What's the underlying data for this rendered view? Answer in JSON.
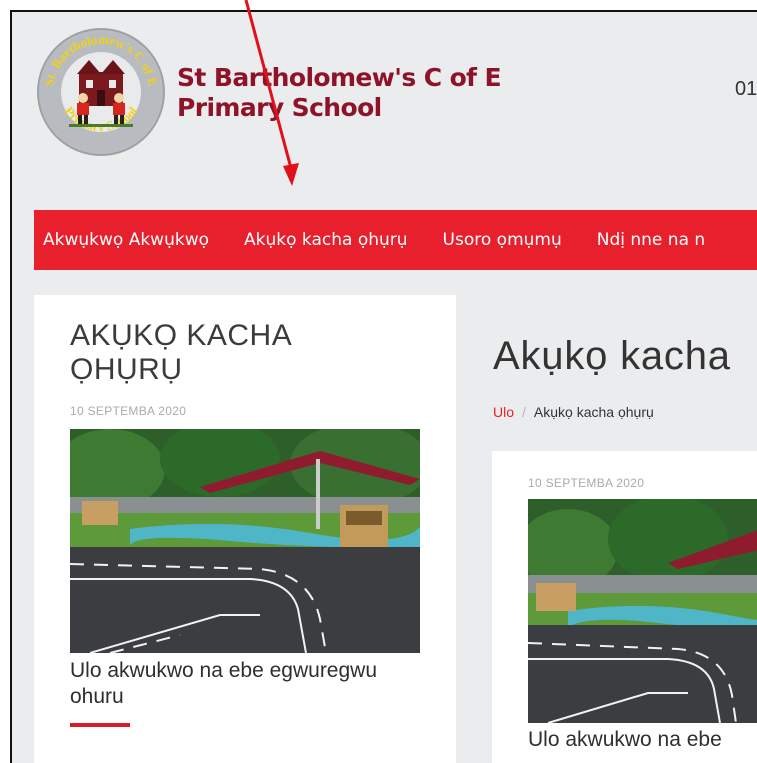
{
  "header": {
    "school_name_line1": "St Bartholomew's C of E",
    "school_name_line2": "Primary School",
    "phone_partial": "01",
    "logo_text_top": "St. Bartholomew's C of E",
    "logo_text_bottom": "Primary School"
  },
  "nav": {
    "items": [
      {
        "label": "Akwụkwọ Akwụkwọ"
      },
      {
        "label": "Akụkọ kacha ọhụrụ"
      },
      {
        "label": "Usoro ọmụmụ"
      },
      {
        "label": "Ndị nne na n"
      }
    ]
  },
  "news_widget": {
    "heading": "AKỤKỌ KACHA ỌHỤRỤ",
    "date": "10 SEPTEMBA 2020",
    "caption": "Ulo akwukwo na ebe egwuregwu ohuru"
  },
  "main": {
    "page_title": "Akụkọ kacha",
    "breadcrumb": {
      "home": "Ulo",
      "separator": "/",
      "current": "Akụkọ kacha ọhụrụ"
    },
    "article": {
      "date": "10 SEPTEMBA 2020",
      "caption": "Ulo akwukwo na ebe"
    }
  },
  "colors": {
    "brand_maroon": "#8e1329",
    "nav_red": "#e8202d",
    "page_bg": "#eaecee",
    "annotation_arrow": "#e0101c"
  },
  "icons": [
    "school-logo-icon",
    "annotation-arrow-icon"
  ]
}
